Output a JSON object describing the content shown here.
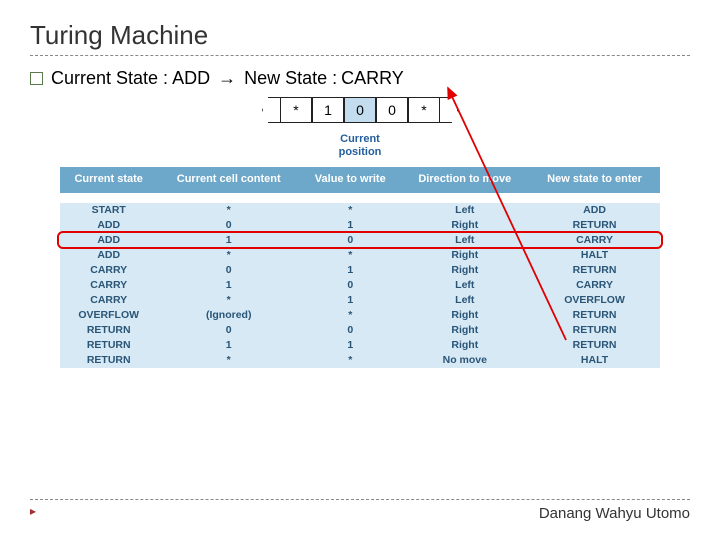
{
  "title": "Turing Machine",
  "bullet": {
    "prefix": "Current State : ",
    "state_from": "ADD",
    "arrow": "→",
    "mid": " New State : ",
    "state_to": "CARRY"
  },
  "tape": {
    "cells": [
      "*",
      "1",
      "0",
      "0",
      "*"
    ],
    "highlight_index": 2,
    "caption": "Current\nposition"
  },
  "table": {
    "headers": [
      "Current state",
      "Current cell content",
      "Value to write",
      "Direction to move",
      "New state to enter"
    ],
    "rows": [
      [
        "START",
        "*",
        "*",
        "Left",
        "ADD"
      ],
      [
        "ADD",
        "0",
        "1",
        "Right",
        "RETURN"
      ],
      [
        "ADD",
        "1",
        "0",
        "Left",
        "CARRY"
      ],
      [
        "ADD",
        "*",
        "*",
        "Right",
        "HALT"
      ],
      [
        "CARRY",
        "0",
        "1",
        "Right",
        "RETURN"
      ],
      [
        "CARRY",
        "1",
        "0",
        "Left",
        "CARRY"
      ],
      [
        "CARRY",
        "*",
        "1",
        "Left",
        "OVERFLOW"
      ],
      [
        "OVERFLOW",
        "(Ignored)",
        "*",
        "Right",
        "RETURN"
      ],
      [
        "RETURN",
        "0",
        "0",
        "Right",
        "RETURN"
      ],
      [
        "RETURN",
        "1",
        "1",
        "Right",
        "RETURN"
      ],
      [
        "RETURN",
        "*",
        "*",
        "No move",
        "HALT"
      ]
    ],
    "highlight_row_index": 2
  },
  "footer_bullet": "▸",
  "author": "Danang Wahyu Utomo"
}
